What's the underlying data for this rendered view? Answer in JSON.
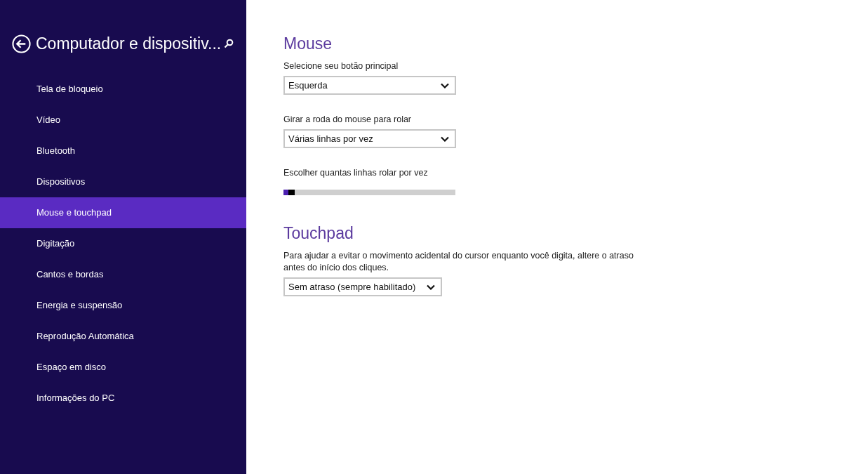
{
  "sidebar": {
    "title": "Computador e dispositiv...",
    "items": [
      {
        "label": "Tela de bloqueio",
        "selected": false
      },
      {
        "label": "Vídeo",
        "selected": false
      },
      {
        "label": "Bluetooth",
        "selected": false
      },
      {
        "label": "Dispositivos",
        "selected": false
      },
      {
        "label": "Mouse e touchpad",
        "selected": true
      },
      {
        "label": "Digitação",
        "selected": false
      },
      {
        "label": "Cantos e bordas",
        "selected": false
      },
      {
        "label": "Energia e suspensão",
        "selected": false
      },
      {
        "label": "Reprodução Automática",
        "selected": false
      },
      {
        "label": "Espaço em disco",
        "selected": false
      },
      {
        "label": "Informações do PC",
        "selected": false
      }
    ]
  },
  "sections": [
    {
      "heading": "Mouse",
      "settings": [
        {
          "kind": "dropdown",
          "label": "Selecione seu botão principal",
          "value": "Esquerda"
        },
        {
          "kind": "dropdown",
          "label": "Girar a roda do mouse para rolar",
          "value": "Várias linhas por vez"
        },
        {
          "kind": "slider",
          "label": "Escolher quantas linhas rolar por vez",
          "level": 0.03
        }
      ]
    },
    {
      "heading": "Touchpad",
      "settings": [
        {
          "kind": "dropdown",
          "label": "Para ajudar a evitar o movimento acidental do cursor enquanto você digita, altere o atraso antes do início dos cliques.",
          "value": "Sem atraso (sempre habilitado)"
        }
      ]
    }
  ]
}
